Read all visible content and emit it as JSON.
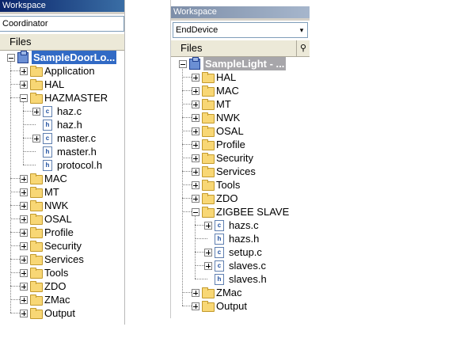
{
  "left": {
    "workspace_title": "Workspace",
    "configuration": "Coordinator",
    "files_header": "Files",
    "items": [
      {
        "label": "SampleDoorLo...",
        "depth": 0,
        "kind": "project",
        "expander": "minus"
      },
      {
        "label": "Application",
        "depth": 1,
        "kind": "folder",
        "expander": "plus"
      },
      {
        "label": "HAL",
        "depth": 1,
        "kind": "folder",
        "expander": "plus"
      },
      {
        "label": "HAZMASTER",
        "depth": 1,
        "kind": "folder",
        "expander": "minus"
      },
      {
        "label": "haz.c",
        "depth": 2,
        "kind": "c",
        "expander": "plus"
      },
      {
        "label": "haz.h",
        "depth": 2,
        "kind": "h",
        "expander": ""
      },
      {
        "label": "master.c",
        "depth": 2,
        "kind": "c",
        "expander": "plus"
      },
      {
        "label": "master.h",
        "depth": 2,
        "kind": "h",
        "expander": ""
      },
      {
        "label": "protocol.h",
        "depth": 2,
        "kind": "h",
        "expander": ""
      },
      {
        "label": "MAC",
        "depth": 1,
        "kind": "folder",
        "expander": "plus"
      },
      {
        "label": "MT",
        "depth": 1,
        "kind": "folder",
        "expander": "plus"
      },
      {
        "label": "NWK",
        "depth": 1,
        "kind": "folder",
        "expander": "plus"
      },
      {
        "label": "OSAL",
        "depth": 1,
        "kind": "folder",
        "expander": "plus"
      },
      {
        "label": "Profile",
        "depth": 1,
        "kind": "folder",
        "expander": "plus"
      },
      {
        "label": "Security",
        "depth": 1,
        "kind": "folder",
        "expander": "plus"
      },
      {
        "label": "Services",
        "depth": 1,
        "kind": "folder",
        "expander": "plus"
      },
      {
        "label": "Tools",
        "depth": 1,
        "kind": "folder",
        "expander": "plus"
      },
      {
        "label": "ZDO",
        "depth": 1,
        "kind": "folder",
        "expander": "plus"
      },
      {
        "label": "ZMac",
        "depth": 1,
        "kind": "folder",
        "expander": "plus"
      },
      {
        "label": "Output",
        "depth": 1,
        "kind": "folder",
        "expander": "plus"
      }
    ]
  },
  "right": {
    "workspace_title": "Workspace",
    "configuration": "EndDevice",
    "files_header": "Files",
    "check_mark": "✔",
    "items": [
      {
        "label": "SampleLight - ...",
        "depth": 0,
        "kind": "project",
        "expander": "minus",
        "checked": true
      },
      {
        "label": "HAL",
        "depth": 1,
        "kind": "folder",
        "expander": "plus"
      },
      {
        "label": "MAC",
        "depth": 1,
        "kind": "folder",
        "expander": "plus"
      },
      {
        "label": "MT",
        "depth": 1,
        "kind": "folder",
        "expander": "plus"
      },
      {
        "label": "NWK",
        "depth": 1,
        "kind": "folder",
        "expander": "plus"
      },
      {
        "label": "OSAL",
        "depth": 1,
        "kind": "folder",
        "expander": "plus"
      },
      {
        "label": "Profile",
        "depth": 1,
        "kind": "folder",
        "expander": "plus"
      },
      {
        "label": "Security",
        "depth": 1,
        "kind": "folder",
        "expander": "plus"
      },
      {
        "label": "Services",
        "depth": 1,
        "kind": "folder",
        "expander": "plus"
      },
      {
        "label": "Tools",
        "depth": 1,
        "kind": "folder",
        "expander": "plus"
      },
      {
        "label": "ZDO",
        "depth": 1,
        "kind": "folder",
        "expander": "plus"
      },
      {
        "label": "ZIGBEE SLAVE",
        "depth": 1,
        "kind": "folder",
        "expander": "minus"
      },
      {
        "label": "hazs.c",
        "depth": 2,
        "kind": "c",
        "expander": "plus"
      },
      {
        "label": "hazs.h",
        "depth": 2,
        "kind": "h",
        "expander": ""
      },
      {
        "label": "setup.c",
        "depth": 2,
        "kind": "c",
        "expander": "plus"
      },
      {
        "label": "slaves.c",
        "depth": 2,
        "kind": "c",
        "expander": "plus"
      },
      {
        "label": "slaves.h",
        "depth": 2,
        "kind": "h",
        "expander": ""
      },
      {
        "label": "ZMac",
        "depth": 1,
        "kind": "folder",
        "expander": "plus"
      },
      {
        "label": "Output",
        "depth": 1,
        "kind": "folder",
        "expander": "plus"
      }
    ]
  },
  "icons": {
    "project": "project-icon",
    "folder": "folder-icon",
    "c": "c-source-file-icon",
    "h": "header-file-icon",
    "plus": "expand-plus-icon",
    "minus": "collapse-minus-icon"
  }
}
